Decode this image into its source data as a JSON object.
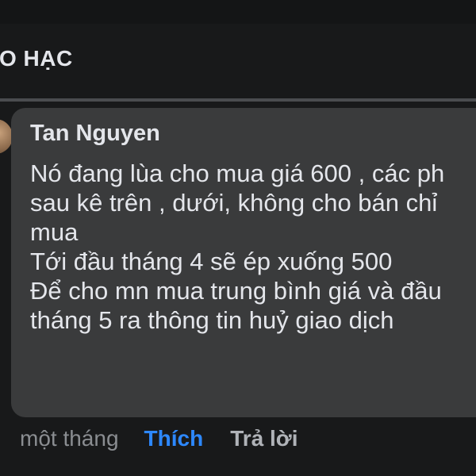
{
  "header": {
    "title": "O HẠC"
  },
  "comment": {
    "author": "Tan Nguyen",
    "lines": [
      "Nó đang lùa cho mua giá 600 , các ph",
      "sau kê trên , dưới, không cho bán chỉ",
      "mua",
      "Tới đầu tháng 4 sẽ ép xuống 500",
      "Để cho mn mua trung bình giá và đầu",
      "tháng 5 ra thông tin huỷ giao dịch"
    ],
    "timestamp": "một tháng",
    "like_label": "Thích",
    "reply_label": "Trả lời"
  },
  "colors": {
    "background": "#18191a",
    "bubble": "#3a3b3c",
    "text": "#e4e6eb",
    "accent_like": "#2d88ff",
    "muted": "#8a8d91"
  }
}
